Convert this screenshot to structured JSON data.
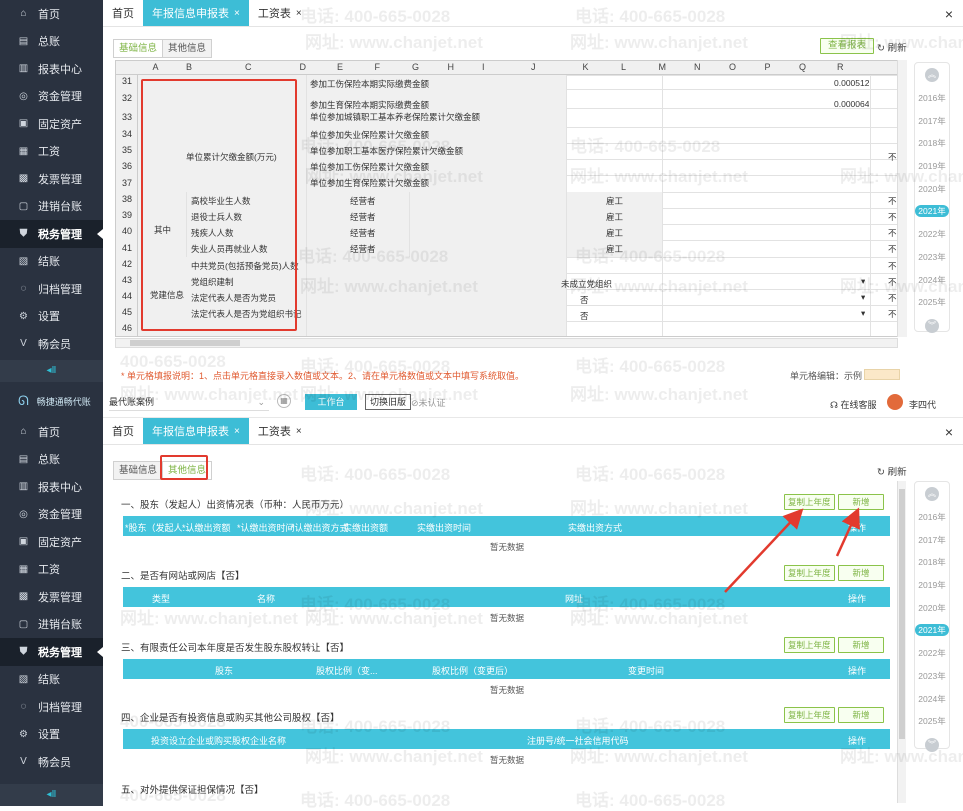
{
  "sidebar": {
    "items": [
      {
        "label": "首页",
        "icon": "home-icon",
        "glyph": "⌂"
      },
      {
        "label": "总账",
        "icon": "ledger-icon",
        "glyph": "▤"
      },
      {
        "label": "报表中心",
        "icon": "chart-icon",
        "glyph": "▥"
      },
      {
        "label": "资金管理",
        "icon": "fund-icon",
        "glyph": "◎"
      },
      {
        "label": "固定资产",
        "icon": "asset-icon",
        "glyph": "▣"
      },
      {
        "label": "工资",
        "icon": "salary-icon",
        "glyph": "▦"
      },
      {
        "label": "发票管理",
        "icon": "invoice-icon",
        "glyph": "▩"
      },
      {
        "label": "进销台账",
        "icon": "inventory-icon",
        "glyph": "▢"
      },
      {
        "label": "税务管理",
        "icon": "tax-icon",
        "glyph": "⛊",
        "active": true
      },
      {
        "label": "结账",
        "icon": "closing-icon",
        "glyph": "▧"
      },
      {
        "label": "归档管理",
        "icon": "archive-icon",
        "glyph": "◌"
      },
      {
        "label": "设置",
        "icon": "settings-icon",
        "glyph": "⚙"
      },
      {
        "label": "畅会员",
        "icon": "member-icon",
        "glyph": "V"
      }
    ],
    "collapse": "◂Ⅱ",
    "logo": "畅捷通畅代账"
  },
  "tabs": [
    {
      "label": "首页"
    },
    {
      "label": "年报信息申报表",
      "closable": true,
      "active": true
    },
    {
      "label": "工资表",
      "closable": true
    }
  ],
  "close_glyph": "×",
  "subtabs": {
    "basic": "基础信息",
    "other": "其他信息"
  },
  "buttons": {
    "save_report": "查看报表",
    "refresh": "刷新",
    "copy_last_year": "复制上年度",
    "add": "新增",
    "workbench": "工作台",
    "switch_old": "切换旧版",
    "unverified": "未认证",
    "online_service": "在线客服",
    "user": "李四代"
  },
  "company_select": "最代账案例",
  "years": [
    "2016年",
    "2017年",
    "2018年",
    "2019年",
    "2020年",
    "2021年",
    "2022年",
    "2023年",
    "2024年",
    "2025年"
  ],
  "selected_year": "2021年",
  "sheet": {
    "columns": [
      "A",
      "B",
      "C",
      "D",
      "E",
      "F",
      "G",
      "H",
      "I",
      "J",
      "K",
      "L",
      "M",
      "N",
      "O",
      "P",
      "Q",
      "R"
    ],
    "rows": [
      "31",
      "32",
      "33",
      "34",
      "35",
      "36",
      "37",
      "38",
      "39",
      "40",
      "41",
      "42",
      "43",
      "44",
      "45",
      "46"
    ],
    "r31": "参加工伤保险本期实际缴费金额",
    "r31_val": "0.000512",
    "r32": "参加生育保险本期实际缴费金额",
    "r32_val": "0.000064",
    "r33": "单位参加城镇职工基本养老保险累计欠缴金额",
    "r34": "单位参加失业保险累计欠缴金额",
    "r35": "单位参加职工基本医疗保险累计欠缴金额",
    "r36": "单位参加工伤保险累计欠缴金额",
    "r37": "单位参加生育保险累计欠缴金额",
    "arrears_group": "单位累计欠缴金额(万元)",
    "r38": "高校毕业生人数",
    "r39": "退役士兵人数",
    "r40": "残疾人人数",
    "r41": "失业人员再就业人数",
    "other_group": "其中",
    "manager": "经营者",
    "employee": "雇工",
    "r42": "中共党员(包括预备党员)人数",
    "r43": "党组织建制",
    "r44": "法定代表人是否为党员",
    "r45": "法定代表人是否为党组织书记",
    "party_group": "党建信息",
    "r43_val": "未成立党组织",
    "no": "否",
    "r_trunc": "不"
  },
  "sheet_note": "* 单元格填报说明：1、点击单元格直接录入数值或文本。2、请在单元格数值或文本中填写系统取值。",
  "cell_edit_label": "单元格编辑：示例",
  "sections": [
    {
      "title": "一、股东（发起人）出资情况表（币种：人民币万元）",
      "columns": [
        "*股东（发起人...",
        "*认缴出资额",
        "*认缴出资时间",
        "*认缴出资方式",
        "实缴出资额",
        "实缴出资时间",
        "实缴出资方式",
        "操作"
      ],
      "empty": "暂无数据"
    },
    {
      "title": "二、是否有网站或网店【否】",
      "columns": [
        "类型",
        "名称",
        "网址",
        "操作"
      ],
      "empty": "暂无数据"
    },
    {
      "title": "三、有限责任公司本年度是否发生股东股权转让【否】",
      "columns": [
        "股东",
        "股权比例（变...",
        "股权比例（变更后）",
        "变更时间",
        "操作"
      ],
      "empty": "暂无数据"
    },
    {
      "title": "四、企业是否有投资信息或购买其他公司股权【否】",
      "columns": [
        "投资设立企业或购买股权企业名称",
        "注册号/统一社会信用代码",
        "操作"
      ],
      "empty": "暂无数据"
    },
    {
      "title": "五、对外提供保证担保情况【否】"
    }
  ],
  "watermark": {
    "phone": "电话: 400-665-0028",
    "site": "网址: www.chanjet.net",
    "phone_short": "400-665-0028"
  },
  "colors": {
    "sidebar": "#2a3240",
    "accent": "#3dbdd6",
    "green": "#7cb342",
    "red": "#e23a2e"
  }
}
